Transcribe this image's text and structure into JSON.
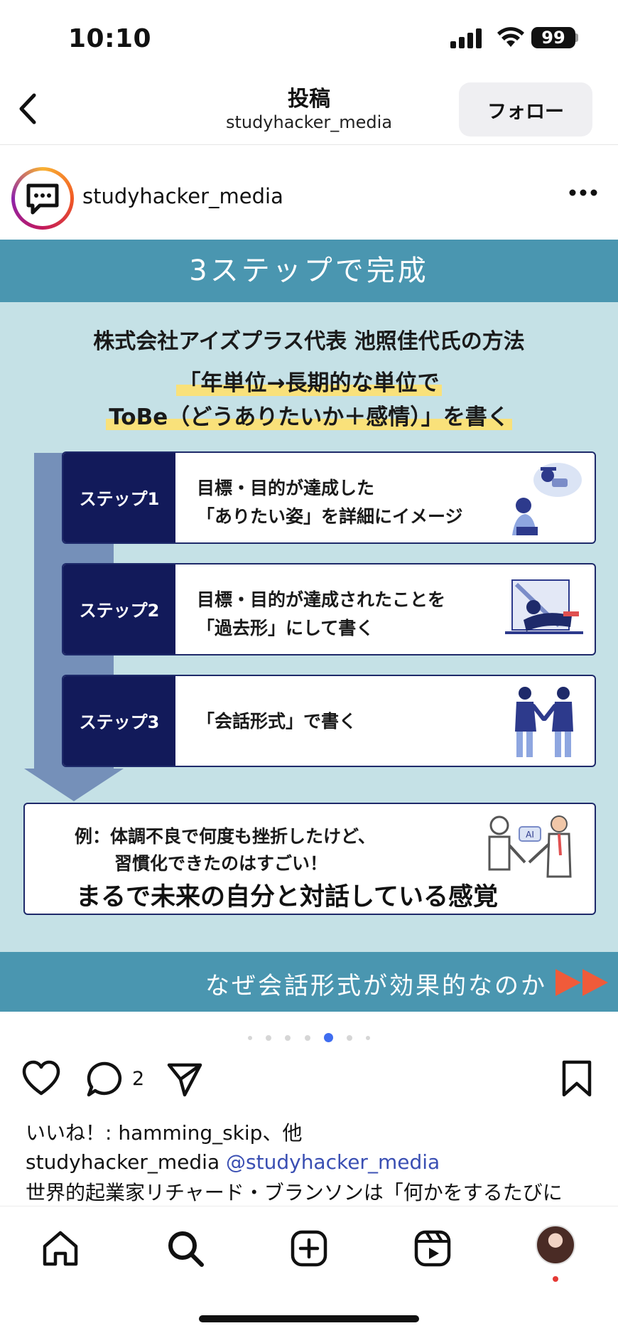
{
  "status": {
    "time": "10:10",
    "battery": "99"
  },
  "nav": {
    "title": "投稿",
    "subtitle": "studyhacker_media",
    "follow_label": "フォロー"
  },
  "post": {
    "username": "studyhacker_media"
  },
  "card": {
    "banner": "3ステップで完成",
    "headline": "株式会社アイズプラス代表 池照佳代氏の方法",
    "highlight_line1": "「年単位→長期的な単位で",
    "highlight_line2": "ToBe（どうありたいか＋感情）」を書く",
    "steps": [
      {
        "label": "ステップ1",
        "line1": "目標・目的が達成した",
        "line2": "「ありたい姿」を詳細にイメージ"
      },
      {
        "label": "ステップ2",
        "line1": "目標・目的が達成されたことを",
        "line2": "「過去形」にして書く"
      },
      {
        "label": "ステップ3",
        "line1": "「会話形式」で書く"
      }
    ],
    "example_line1": "例：体調不良で何度も挫折したけど、",
    "example_line2": "習慣化できたのはすごい！",
    "example_main": "まるで未来の自分と対話している感覚",
    "example_ai_tag": "AI",
    "footer": "なぜ会話形式が効果的なのか"
  },
  "carousel": {
    "total": 7,
    "active_index": 4
  },
  "actions": {
    "comment_count": "2"
  },
  "likes": {
    "prefix": "いいね！: ",
    "user": "hamming_skip",
    "suffix": "、他"
  },
  "caption": {
    "username": "studyhacker_media",
    "mention": "@studyhacker_media",
    "text": "世界的起業家リチャード・ブランソンは「何かをするたびに"
  },
  "colors": {
    "banner": "#4a96b0",
    "card_bg": "#c5e1e6",
    "step_label": "#121a5a",
    "highlight": "#f9e17a",
    "mention": "#3a4fb3",
    "active_dot": "#3f6df0"
  }
}
